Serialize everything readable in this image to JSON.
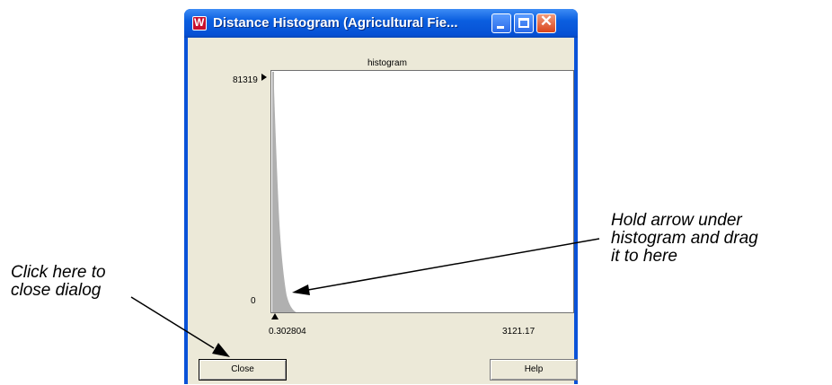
{
  "window": {
    "title": "Distance Histogram (Agricultural Fie...",
    "controls": {
      "minimize": "minimize-icon",
      "maximize": "maximize-icon",
      "close": "close-icon"
    }
  },
  "histogram": {
    "label": "histogram",
    "y_max_label": "81319",
    "y_min_label": "0",
    "x_min_label": "0.302804",
    "x_max_label": "3121.17"
  },
  "buttons": {
    "close_label": "Close",
    "help_label": "Help"
  },
  "annotations": {
    "drag_note": "Hold arrow under\nhistogram and drag\nit to here",
    "close_note": "Click here to\nclose dialog"
  },
  "colors": {
    "titlebar": "#0b5fe0",
    "dialog_bg": "#ece9d8",
    "plot_bg": "#ffffff",
    "histogram_fill": "#b0b0b0"
  }
}
